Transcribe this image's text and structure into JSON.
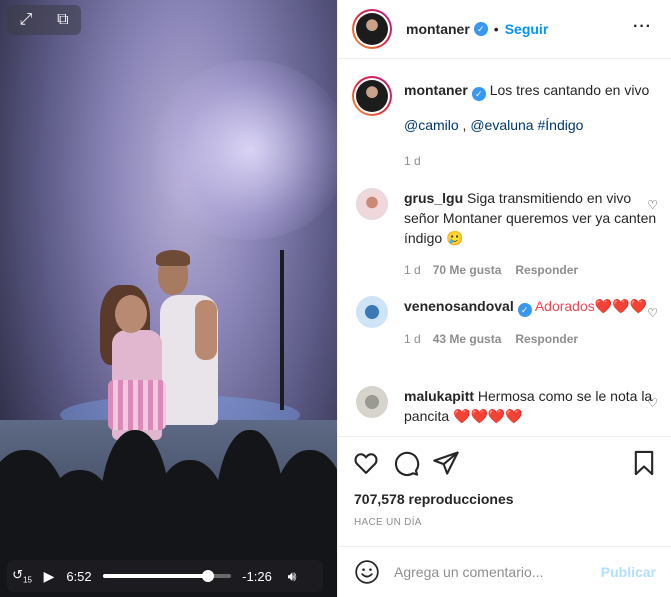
{
  "video": {
    "expand_icon": "expand-arrows-icon",
    "pip_icon": "picture-in-picture-icon",
    "controls": {
      "replay_label": "15",
      "current_time": "6:52",
      "remaining_time": "-1:26",
      "progress_fraction": 0.82
    }
  },
  "header": {
    "username": "montaner",
    "separator": "•",
    "follow_label": "Seguir",
    "more_label": "···"
  },
  "caption": {
    "username": "montaner",
    "text": "Los tres cantando en vivo",
    "mention1": "@camilo",
    "separator": " , ",
    "mention2": "@evaluna",
    "hashtag": "#Índigo",
    "time": "1 d"
  },
  "comments": [
    {
      "username": "grus_lgu",
      "text": "Siga transmitiendo en vivo señor Montaner queremos ver ya canten índigo 🥲",
      "time": "1 d",
      "likes": "70 Me gusta",
      "reply": "Responder",
      "verified": false
    },
    {
      "username": "venenosandoval",
      "text": "Adorados❤️❤️❤️",
      "time": "1 d",
      "likes": "43 Me gusta",
      "reply": "Responder",
      "verified": true
    },
    {
      "username": "malukapitt",
      "text": "Hermosa como se le nota la pancita ❤️❤️❤️❤️",
      "verified": false
    }
  ],
  "actions": {
    "views": "707,578 reproducciones",
    "posted": "HACE UN DÍA"
  },
  "add_comment": {
    "placeholder": "Agrega un comentario...",
    "post_label": "Publicar"
  },
  "colors": {
    "link_blue": "#0095f6",
    "verified_blue": "#3897f0",
    "mention_dark_blue": "#00376b",
    "muted_gray": "#8e8e8e",
    "post_disabled": "#b2dffc"
  }
}
